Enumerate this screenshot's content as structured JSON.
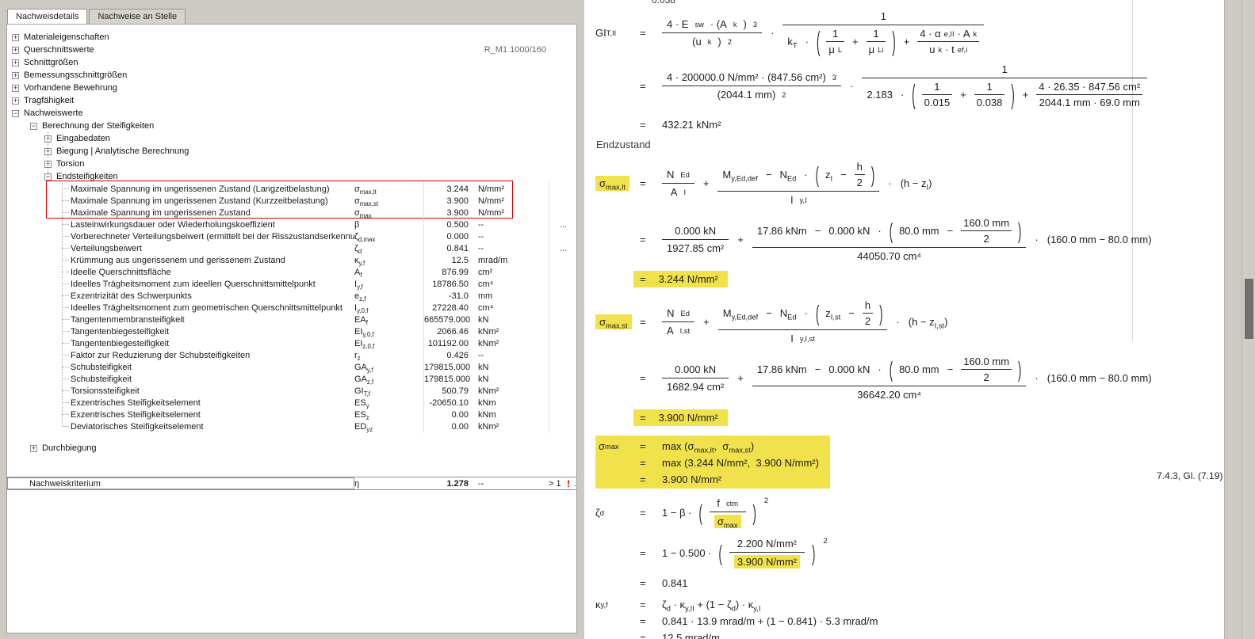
{
  "icons": {
    "plus": "+",
    "minus": "−"
  },
  "sym": {
    "eq": "=",
    "plus": "+",
    "minus": "−",
    "dot": "·",
    "lp": "(",
    "rp": ")",
    "two": "2"
  },
  "tabs": {
    "active": "Nachweisdetails",
    "inactive": "Nachweise an Stelle"
  },
  "tree": {
    "items": [
      "Materialeigenschaften",
      "Querschnittswerte",
      "Schnittgrößen",
      "Bemessungsschnittgrößen",
      "Vorhandene Bewehrung",
      "Tragfähigkeit",
      "Nachweiswerte"
    ],
    "section_ref": "R_M1 1000/160",
    "level2": "Berechnung der Steifigkeiten",
    "level3": [
      "Eingabedaten",
      "Biegung | Analytische Berechnung",
      "Torsion",
      "Endsteifigkeiten"
    ],
    "durchbiegung": "Durchbiegung"
  },
  "rows": [
    {
      "label": "Maximale Spannung im ungerissenen Zustand (Langzeitbelastung)",
      "sym": "σ<sub>max,lt</sub>",
      "value": "3.244",
      "unit": "N/mm²",
      "dots": ""
    },
    {
      "label": "Maximale Spannung im ungerissenen Zustand (Kurzzeitbelastung)",
      "sym": "σ<sub>max,st</sub>",
      "value": "3.900",
      "unit": "N/mm²",
      "dots": ""
    },
    {
      "label": "Maximale Spannung im ungerissenen Zustand",
      "sym": "σ<sub>max</sub>",
      "value": "3.900",
      "unit": "N/mm²",
      "dots": ""
    },
    {
      "label": "Lasteinwirkungsdauer oder Wiederholungskoeffizient",
      "sym": "β",
      "value": "0.500",
      "unit": "--",
      "dots": "..."
    },
    {
      "label": "Vorberechneter Verteilungsbeiwert (ermittelt bei der Risszustandserkennu...",
      "sym": "ζ<sub>d,max</sub>",
      "value": "0.000",
      "unit": "--",
      "dots": ""
    },
    {
      "label": "Verteilungsbeiwert",
      "sym": "ζ<sub>d</sub>",
      "value": "0.841",
      "unit": "--",
      "dots": "..."
    },
    {
      "label": "Krümmung aus ungerissenem und gerissenem Zustand",
      "sym": "κ<sub>y,f</sub>",
      "value": "12.5",
      "unit": "mrad/m",
      "dots": ""
    },
    {
      "label": "Ideelle Querschnittsfläche",
      "sym": "A<sub>f</sub>",
      "value": "876.99",
      "unit": "cm²",
      "dots": ""
    },
    {
      "label": "Ideelles Trägheitsmoment zum ideellen Querschnittsmittelpunkt",
      "sym": "I<sub>y,f</sub>",
      "value": "18786.50",
      "unit": "cm⁴",
      "dots": ""
    },
    {
      "label": "Exzentrizität des Schwerpunkts",
      "sym": "e<sub>z,f</sub>",
      "value": "-31.0",
      "unit": "mm",
      "dots": ""
    },
    {
      "label": "Ideelles Trägheitsmoment zum geometrischen Querschnittsmittelpunkt",
      "sym": "I<sub>y,0,f</sub>",
      "value": "27228.40",
      "unit": "cm⁴",
      "dots": ""
    },
    {
      "label": "Tangentenmembransteifigkeit",
      "sym": "EA<sub>f</sub>",
      "value": "665579.000",
      "unit": "kN",
      "dots": ""
    },
    {
      "label": "Tangentenbiegesteifigkeit",
      "sym": "EI<sub>y,0,f</sub>",
      "value": "2066.46",
      "unit": "kNm²",
      "dots": ""
    },
    {
      "label": "Tangentenbiegesteifigkeit",
      "sym": "EI<sub>z,0,f</sub>",
      "value": "101192.00",
      "unit": "kNm²",
      "dots": ""
    },
    {
      "label": "Faktor zur Reduzierung der Schubsteifigkeiten",
      "sym": "r<sub>z</sub>",
      "value": "0.426",
      "unit": "--",
      "dots": ""
    },
    {
      "label": "Schubsteifigkeit",
      "sym": "GA<sub>y,f</sub>",
      "value": "179815.000",
      "unit": "kN",
      "dots": ""
    },
    {
      "label": "Schubsteifigkeit",
      "sym": "GA<sub>z,f</sub>",
      "value": "179815.000",
      "unit": "kN",
      "dots": ""
    },
    {
      "label": "Torsionssteifigkeit",
      "sym": "GI<sub>T,f</sub>",
      "value": "500.79",
      "unit": "kNm²",
      "dots": ""
    },
    {
      "label": "Exzentrisches Steifigkeitselement",
      "sym": "ES<sub>y</sub>",
      "value": "-20650.10",
      "unit": "kNm",
      "dots": ""
    },
    {
      "label": "Exzentrisches Steifigkeitselement",
      "sym": "ES<sub>z</sub>",
      "value": "0.00",
      "unit": "kNm",
      "dots": ""
    },
    {
      "label": "Deviatorisches Steifigkeitselement",
      "sym": "ED<sub>yz</sub>",
      "value": "0.00",
      "unit": "kNm²",
      "dots": ""
    }
  ],
  "criterion": {
    "label": "Nachweiskriterium",
    "sym": "η",
    "value": "1.278",
    "unit": "--",
    "limit": "> 1",
    "warn": "!",
    "dots": "..."
  },
  "report": {
    "clip": "0.038",
    "endzustand": "Endzustand",
    "ref": "7.4.3, Gl. (7.19)",
    "gi": {
      "lhs": "GI<sub>T,II</sub>",
      "n1": "4 · E<sub>sw</sub> · (A<sub>k</sub>)<sup>3</sup>",
      "d1": "(u<sub>k</sub>)<sup>2</sup>",
      "one": "1",
      "kt": "k<sub>T</sub>",
      "mu_n": "1",
      "mu_l": "μ<sub>L</sub>",
      "mu_li": "μ<sub>Li</sub>",
      "n2": "4 · α<sub>e,II</sub> · A<sub>k</sub>",
      "d2": "u<sub>k</sub> · t<sub>ef,i</sub>",
      "v_n1": "4 · 200000.0 N/mm² · (847.56 cm²)<sup>3</sup>",
      "v_d1": "(2044.1 mm)<sup>2</sup>",
      "v_kt": "2.183",
      "v_mu1n": "1",
      "v_mu1d": "0.015",
      "v_mu2n": "1",
      "v_mu2d": "0.038",
      "v_n2": "4 · 26.35 · 847.56 cm²",
      "v_d2": "2044.1 mm · 69.0 mm",
      "result": "432.21 kNm²"
    },
    "slt": {
      "lhs": "σ<sub>max,lt</sub>",
      "f1n": "N<sub>Ed</sub>",
      "f1d": "A<sub>I</sub>",
      "m": "M<sub>y,Ed,def</sub>",
      "n": "N<sub>Ed</sub>",
      "z": "z<sub>I</sub>",
      "hn": "h",
      "hd": "2",
      "iden": "I<sub>y,I</sub>",
      "tail": "(h − z<sub>I</sub>)",
      "v_f1n": "0.000 kN",
      "v_f1d": "1927.85 cm²",
      "v_m": "17.86 kNm",
      "v_n": "0.000 kN",
      "v_z": "80.0 mm",
      "v_hn": "160.0 mm",
      "v_hd": "2",
      "v_iden": "44050.70 cm⁴",
      "v_tail": "(160.0 mm − 80.0 mm)",
      "result": "3.244 N/mm²"
    },
    "sst": {
      "lhs": "σ<sub>max,st</sub>",
      "f1n": "N<sub>Ed</sub>",
      "f1d": "A<sub>I,st</sub>",
      "m": "M<sub>y,Ed,def</sub>",
      "n": "N<sub>Ed</sub>",
      "z": "z<sub>I,st</sub>",
      "hn": "h",
      "hd": "2",
      "iden": "I<sub>y,I,st</sub>",
      "tail": "(h − z<sub>I,st</sub>)",
      "v_f1n": "0.000 kN",
      "v_f1d": "1682.94 cm²",
      "v_m": "17.86 kNm",
      "v_n": "0.000 kN",
      "v_z": "80.0 mm",
      "v_hn": "160.0 mm",
      "v_hd": "2",
      "v_iden": "36642.20 cm⁴",
      "v_tail": "(160.0 mm − 80.0 mm)",
      "result": "3.900 N/mm²"
    },
    "smax": {
      "lhs": "σ<sub>max</sub>",
      "l1": "max (σ<sub>max,lt</sub>,&nbsp; σ<sub>max,st</sub>)",
      "l2": "max (3.244 N/mm²,&nbsp; 3.900 N/mm²)",
      "l3": "3.900 N/mm²"
    },
    "zeta": {
      "lhs": "ζ<sub>d</sub>",
      "pre": "1 − β ·",
      "fn": "f<sub>ctm</sub>",
      "fd": "σ<sub>max</sub>",
      "v_pre": "1 − 0.500 ·",
      "v_fn": "2.200 N/mm²",
      "v_fd": "3.900 N/mm²",
      "result": "0.841"
    },
    "kappa": {
      "lhs": "κ<sub>y,f</sub>",
      "l1": "ζ<sub>d</sub> · κ<sub>y,II</sub> + (1 − ζ<sub>d</sub>) · κ<sub>y,I</sub>",
      "l2": "0.841 · 13.9 mrad/m + (1 − 0.841) · 5.3 mrad/m",
      "l3": "12.5 mrad/m"
    }
  }
}
